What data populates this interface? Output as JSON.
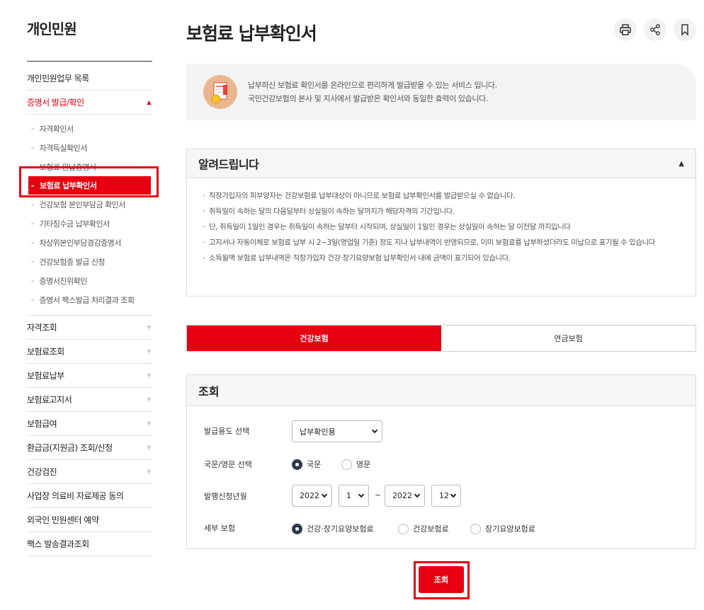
{
  "sidebar": {
    "title": "개인민원",
    "top_item": "개인민원업무 목록",
    "active_group": "증명서 발급/확인",
    "sub_items": [
      "자격확인서",
      "자격득실확인서",
      "보험료 완납증명서",
      "보험료 납부확인서",
      "건강보험 본인부담금 확인서",
      "기타징수금 납부확인서",
      "차상위본인부담경감증명서",
      "건강보험증 발급 신청",
      "증명서진위확인",
      "증명서 팩스발급 처리결과 조회"
    ],
    "groups": [
      "자격조회",
      "보험료조회",
      "보험료납부",
      "보험료고지서",
      "보험급여",
      "환급금(지원금) 조회/신청",
      "건강검진"
    ],
    "plain_items": [
      "사업장 의료비 자료제공 동의",
      "외국인 민원센터 예약",
      "팩스 발송결과조회"
    ]
  },
  "header": {
    "title": "보험료 납부확인서"
  },
  "icons": {
    "print": "print-icon",
    "share": "share-icon",
    "bookmark": "bookmark-icon",
    "service": "document-coin-icon"
  },
  "banner": {
    "line1": "납부하신 보험료 확인서를 온라인으로 편리하게 발급받을 수 있는 서비스 입니다.",
    "line2": "국민건강보험의 본사 및 지사에서 발급받은 확인서와 동일한 효력이 있습니다."
  },
  "notice": {
    "title": "알려드립니다",
    "items": [
      "직장가입자의 피부양자는 건강보험료 납부대상이 아니므로 보험료 납부확인서를 발급받으실 수 없습니다.",
      "취득일이 속하는 달의 다음달부터 상실일이 속하는 달까지가 해당자격의 기간입니다.",
      "단, 취득일이 1일인 경우는 취득일이 속하는 달부터 시작되며, 상실일이 1일인 경우는 상실일이 속하는 달 이전달 까지입니다",
      "고지서나 자동이체로 보험료 납부 시 2~3일(영업일 기준) 정도 지나 납부내역이 반영되므로, 이미 보험료를 납부하셨더라도 미납으로 표기될 수 있습니다",
      "소득월액 보험료 납부내역은 직장가입자 건강·장기요양보험 납부확인서 내에 금액이 표기되어 있습니다."
    ]
  },
  "tabs": [
    "건강보험",
    "연금보험"
  ],
  "search": {
    "title": "조회",
    "purpose_label": "발급용도 선택",
    "purpose_value": "납부확인용",
    "lang_label": "국문/영문 선택",
    "lang_options": [
      "국문",
      "영문"
    ],
    "period_label": "발행신청년월",
    "from_year": "2022",
    "from_month": "1",
    "tilde": "~",
    "to_year": "2022",
    "to_month": "12",
    "detail_label": "세부 보험",
    "detail_options": [
      "건강·장기요양보험료",
      "건강보험료",
      "장기요양보험료"
    ],
    "submit": "조회"
  },
  "colors": {
    "accent": "#e60012",
    "radio_checked": "#2d3a4b"
  }
}
